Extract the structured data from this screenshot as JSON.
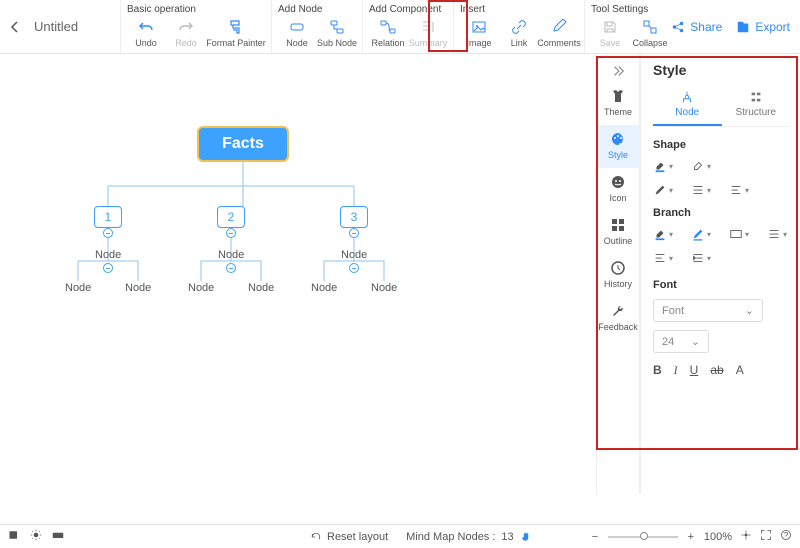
{
  "doc_title": "Untitled",
  "toolbar": {
    "groups": {
      "basic": {
        "label": "Basic operation",
        "undo": "Undo",
        "redo": "Redo",
        "format": "Format Painter"
      },
      "addnode": {
        "label": "Add Node",
        "node": "Node",
        "subnode": "Sub Node"
      },
      "addcomp": {
        "label": "Add Component",
        "relation": "Relation",
        "summary": "Summary"
      },
      "insert": {
        "label": "Insert",
        "image": "Image",
        "link": "Link",
        "comments": "Comments"
      },
      "tools": {
        "label": "Tool Settings",
        "save": "Save",
        "collapse": "Collapse"
      }
    },
    "share": "Share",
    "export": "Export"
  },
  "map": {
    "root": "Facts",
    "children": [
      "1",
      "2",
      "3"
    ],
    "node_label": "Node"
  },
  "rail": {
    "items": [
      "Theme",
      "Style",
      "Icon",
      "Outline",
      "History",
      "Feedback"
    ],
    "active": 1
  },
  "panel": {
    "title": "Style",
    "tabs": [
      "Node",
      "Structure"
    ],
    "active_tab": 0,
    "sections": {
      "shape": "Shape",
      "branch": "Branch",
      "font": "Font"
    },
    "font_select": "Font",
    "size_select": "24",
    "font_buttons": [
      "B",
      "I",
      "U",
      "ab",
      "A"
    ]
  },
  "status": {
    "reset": "Reset layout",
    "mindmap": "Mind Map Nodes :",
    "count": "13",
    "zoom": "100%"
  }
}
